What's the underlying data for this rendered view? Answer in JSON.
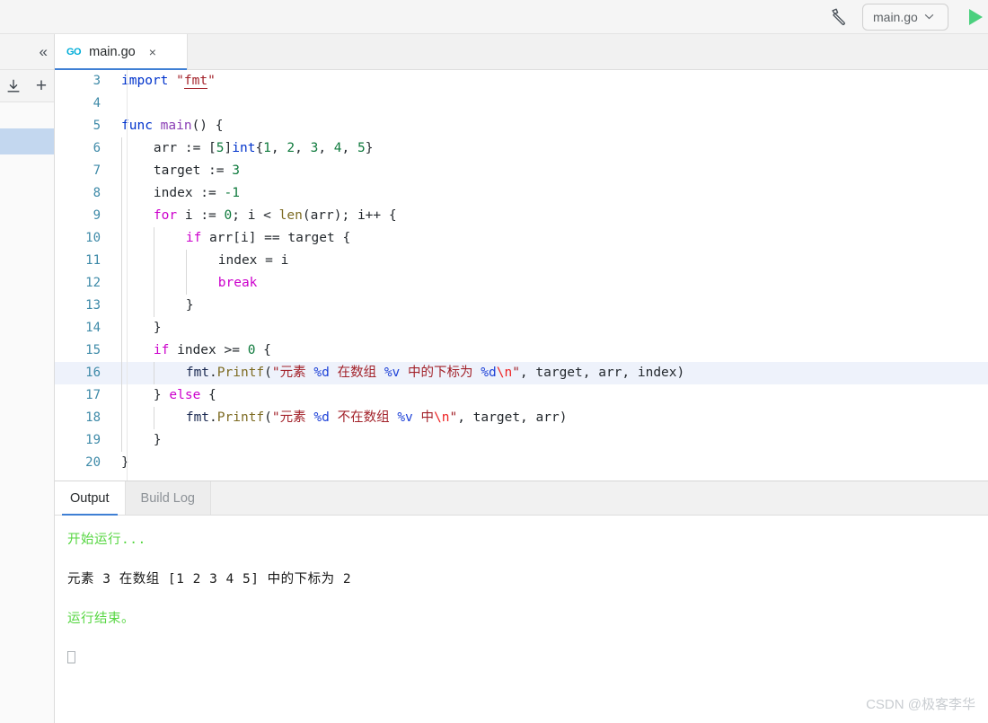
{
  "toolbar": {
    "build_icon": "hammer-icon",
    "file_selector_value": "main.go",
    "caret_glyph": "⌄",
    "run_icon": "play-triangle-icon"
  },
  "sidebar": {
    "collapse_icon": "«",
    "collapse_name": "collapse-panel-icon",
    "download_icon": "download-icon",
    "plus_icon": "+",
    "files": [
      {
        "label": "",
        "selected": false
      },
      {
        "label": "",
        "selected": true
      },
      {
        "label": "",
        "selected": false
      }
    ]
  },
  "editor_tabs": [
    {
      "icon": "GO",
      "label": "main.go",
      "close": "×",
      "active": true
    }
  ],
  "code": {
    "language": "go",
    "first_visible_line": 3,
    "current_line": 16,
    "lines": [
      {
        "n": 3,
        "indent": 0,
        "tokens": [
          {
            "t": "import",
            "c": "t-kw"
          },
          {
            "t": " ",
            "c": "t-plain"
          },
          {
            "t": "\"",
            "c": "t-str"
          },
          {
            "t": "fmt",
            "c": "t-str-u"
          },
          {
            "t": "\"",
            "c": "t-str"
          }
        ]
      },
      {
        "n": 4,
        "indent": 0,
        "tokens": []
      },
      {
        "n": 5,
        "indent": 0,
        "tokens": [
          {
            "t": "func",
            "c": "t-kw"
          },
          {
            "t": " ",
            "c": "t-plain"
          },
          {
            "t": "main",
            "c": "t-fname"
          },
          {
            "t": "() {",
            "c": "t-plain"
          }
        ]
      },
      {
        "n": 6,
        "indent": 1,
        "tokens": [
          {
            "t": "arr := [",
            "c": "t-plain"
          },
          {
            "t": "5",
            "c": "t-num"
          },
          {
            "t": "]",
            "c": "t-plain"
          },
          {
            "t": "int",
            "c": "t-type"
          },
          {
            "t": "{",
            "c": "t-plain"
          },
          {
            "t": "1",
            "c": "t-num"
          },
          {
            "t": ", ",
            "c": "t-plain"
          },
          {
            "t": "2",
            "c": "t-num"
          },
          {
            "t": ", ",
            "c": "t-plain"
          },
          {
            "t": "3",
            "c": "t-num"
          },
          {
            "t": ", ",
            "c": "t-plain"
          },
          {
            "t": "4",
            "c": "t-num"
          },
          {
            "t": ", ",
            "c": "t-plain"
          },
          {
            "t": "5",
            "c": "t-num"
          },
          {
            "t": "}",
            "c": "t-plain"
          }
        ]
      },
      {
        "n": 7,
        "indent": 1,
        "tokens": [
          {
            "t": "target := ",
            "c": "t-plain"
          },
          {
            "t": "3",
            "c": "t-num"
          }
        ]
      },
      {
        "n": 8,
        "indent": 1,
        "tokens": [
          {
            "t": "index := ",
            "c": "t-plain"
          },
          {
            "t": "-1",
            "c": "t-num"
          }
        ]
      },
      {
        "n": 9,
        "indent": 1,
        "tokens": [
          {
            "t": "for",
            "c": "t-ctrl"
          },
          {
            "t": " i := ",
            "c": "t-plain"
          },
          {
            "t": "0",
            "c": "t-num"
          },
          {
            "t": "; i < ",
            "c": "t-plain"
          },
          {
            "t": "len",
            "c": "t-fn"
          },
          {
            "t": "(arr); i++ {",
            "c": "t-plain"
          }
        ]
      },
      {
        "n": 10,
        "indent": 2,
        "tokens": [
          {
            "t": "if",
            "c": "t-ctrl"
          },
          {
            "t": " arr[i] == target {",
            "c": "t-plain"
          }
        ]
      },
      {
        "n": 11,
        "indent": 3,
        "tokens": [
          {
            "t": "index = i",
            "c": "t-plain"
          }
        ]
      },
      {
        "n": 12,
        "indent": 3,
        "tokens": [
          {
            "t": "break",
            "c": "t-ctrl"
          }
        ]
      },
      {
        "n": 13,
        "indent": 2,
        "tokens": [
          {
            "t": "}",
            "c": "t-plain"
          }
        ]
      },
      {
        "n": 14,
        "indent": 1,
        "tokens": [
          {
            "t": "}",
            "c": "t-plain"
          }
        ]
      },
      {
        "n": 15,
        "indent": 1,
        "tokens": [
          {
            "t": "if",
            "c": "t-ctrl"
          },
          {
            "t": " index >= ",
            "c": "t-plain"
          },
          {
            "t": "0",
            "c": "t-num"
          },
          {
            "t": " {",
            "c": "t-plain"
          }
        ]
      },
      {
        "n": 16,
        "indent": 2,
        "tokens": [
          {
            "t": "fmt",
            "c": "t-pkg"
          },
          {
            "t": ".",
            "c": "t-plain"
          },
          {
            "t": "Printf",
            "c": "t-fn"
          },
          {
            "t": "(",
            "c": "t-plain"
          },
          {
            "t": "\"元素 ",
            "c": "t-str"
          },
          {
            "t": "%d",
            "c": "t-verb"
          },
          {
            "t": " 在数组 ",
            "c": "t-str"
          },
          {
            "t": "%v",
            "c": "t-verb"
          },
          {
            "t": " 中的下标为 ",
            "c": "t-str"
          },
          {
            "t": "%d",
            "c": "t-verb"
          },
          {
            "t": "\\n",
            "c": "t-esc"
          },
          {
            "t": "\"",
            "c": "t-str"
          },
          {
            "t": ", target, arr, index)",
            "c": "t-plain"
          }
        ]
      },
      {
        "n": 17,
        "indent": 1,
        "tokens": [
          {
            "t": "} ",
            "c": "t-plain"
          },
          {
            "t": "else",
            "c": "t-ctrl"
          },
          {
            "t": " {",
            "c": "t-plain"
          }
        ]
      },
      {
        "n": 18,
        "indent": 2,
        "tokens": [
          {
            "t": "fmt",
            "c": "t-pkg"
          },
          {
            "t": ".",
            "c": "t-plain"
          },
          {
            "t": "Printf",
            "c": "t-fn"
          },
          {
            "t": "(",
            "c": "t-plain"
          },
          {
            "t": "\"元素 ",
            "c": "t-str"
          },
          {
            "t": "%d",
            "c": "t-verb"
          },
          {
            "t": " 不在数组 ",
            "c": "t-str"
          },
          {
            "t": "%v",
            "c": "t-verb"
          },
          {
            "t": " 中",
            "c": "t-str"
          },
          {
            "t": "\\n",
            "c": "t-esc"
          },
          {
            "t": "\"",
            "c": "t-str"
          },
          {
            "t": ", target, arr)",
            "c": "t-plain"
          }
        ]
      },
      {
        "n": 19,
        "indent": 1,
        "tokens": [
          {
            "t": "}",
            "c": "t-plain"
          }
        ]
      },
      {
        "n": 20,
        "indent": 0,
        "tokens": [
          {
            "t": "}",
            "c": "t-plain"
          }
        ]
      }
    ]
  },
  "panel": {
    "tabs": [
      {
        "label": "Output",
        "active": true
      },
      {
        "label": "Build Log",
        "active": false
      }
    ],
    "output_lines": [
      {
        "text": "开始运行...",
        "color": "green"
      },
      {
        "text": "元素 3 在数组 [1 2 3 4 5] 中的下标为 2",
        "color": "black"
      },
      {
        "text": "运行结束。",
        "color": "green"
      },
      {
        "text": "⎕",
        "color": "cursor"
      }
    ]
  },
  "watermark": {
    "text": "CSDN @极客李华"
  },
  "colors": {
    "accent_blue": "#3f7fd4",
    "run_green": "#4bd07e",
    "selection_blue": "#c3d7ef",
    "current_line": "#eef2fb",
    "go_cyan": "#00add8",
    "output_green": "#55d640"
  }
}
